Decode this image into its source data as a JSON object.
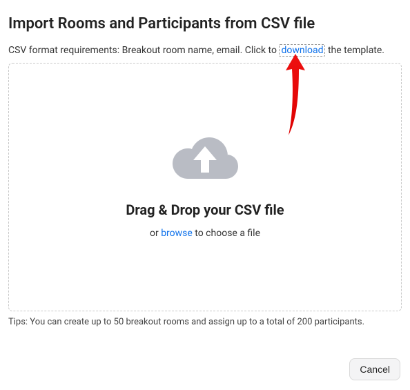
{
  "title": "Import Rooms and Participants from CSV file",
  "format": {
    "prefix": "CSV format requirements: Breakout room name, email. Click to ",
    "link": "download",
    "suffix": " the template."
  },
  "dropzone": {
    "title": "Drag & Drop your CSV file",
    "sub_prefix": "or ",
    "browse": "browse",
    "sub_suffix": " to choose a file"
  },
  "tips": "Tips: You can create up to 50 breakout rooms and assign up to a total of 200 participants.",
  "buttons": {
    "cancel": "Cancel"
  }
}
